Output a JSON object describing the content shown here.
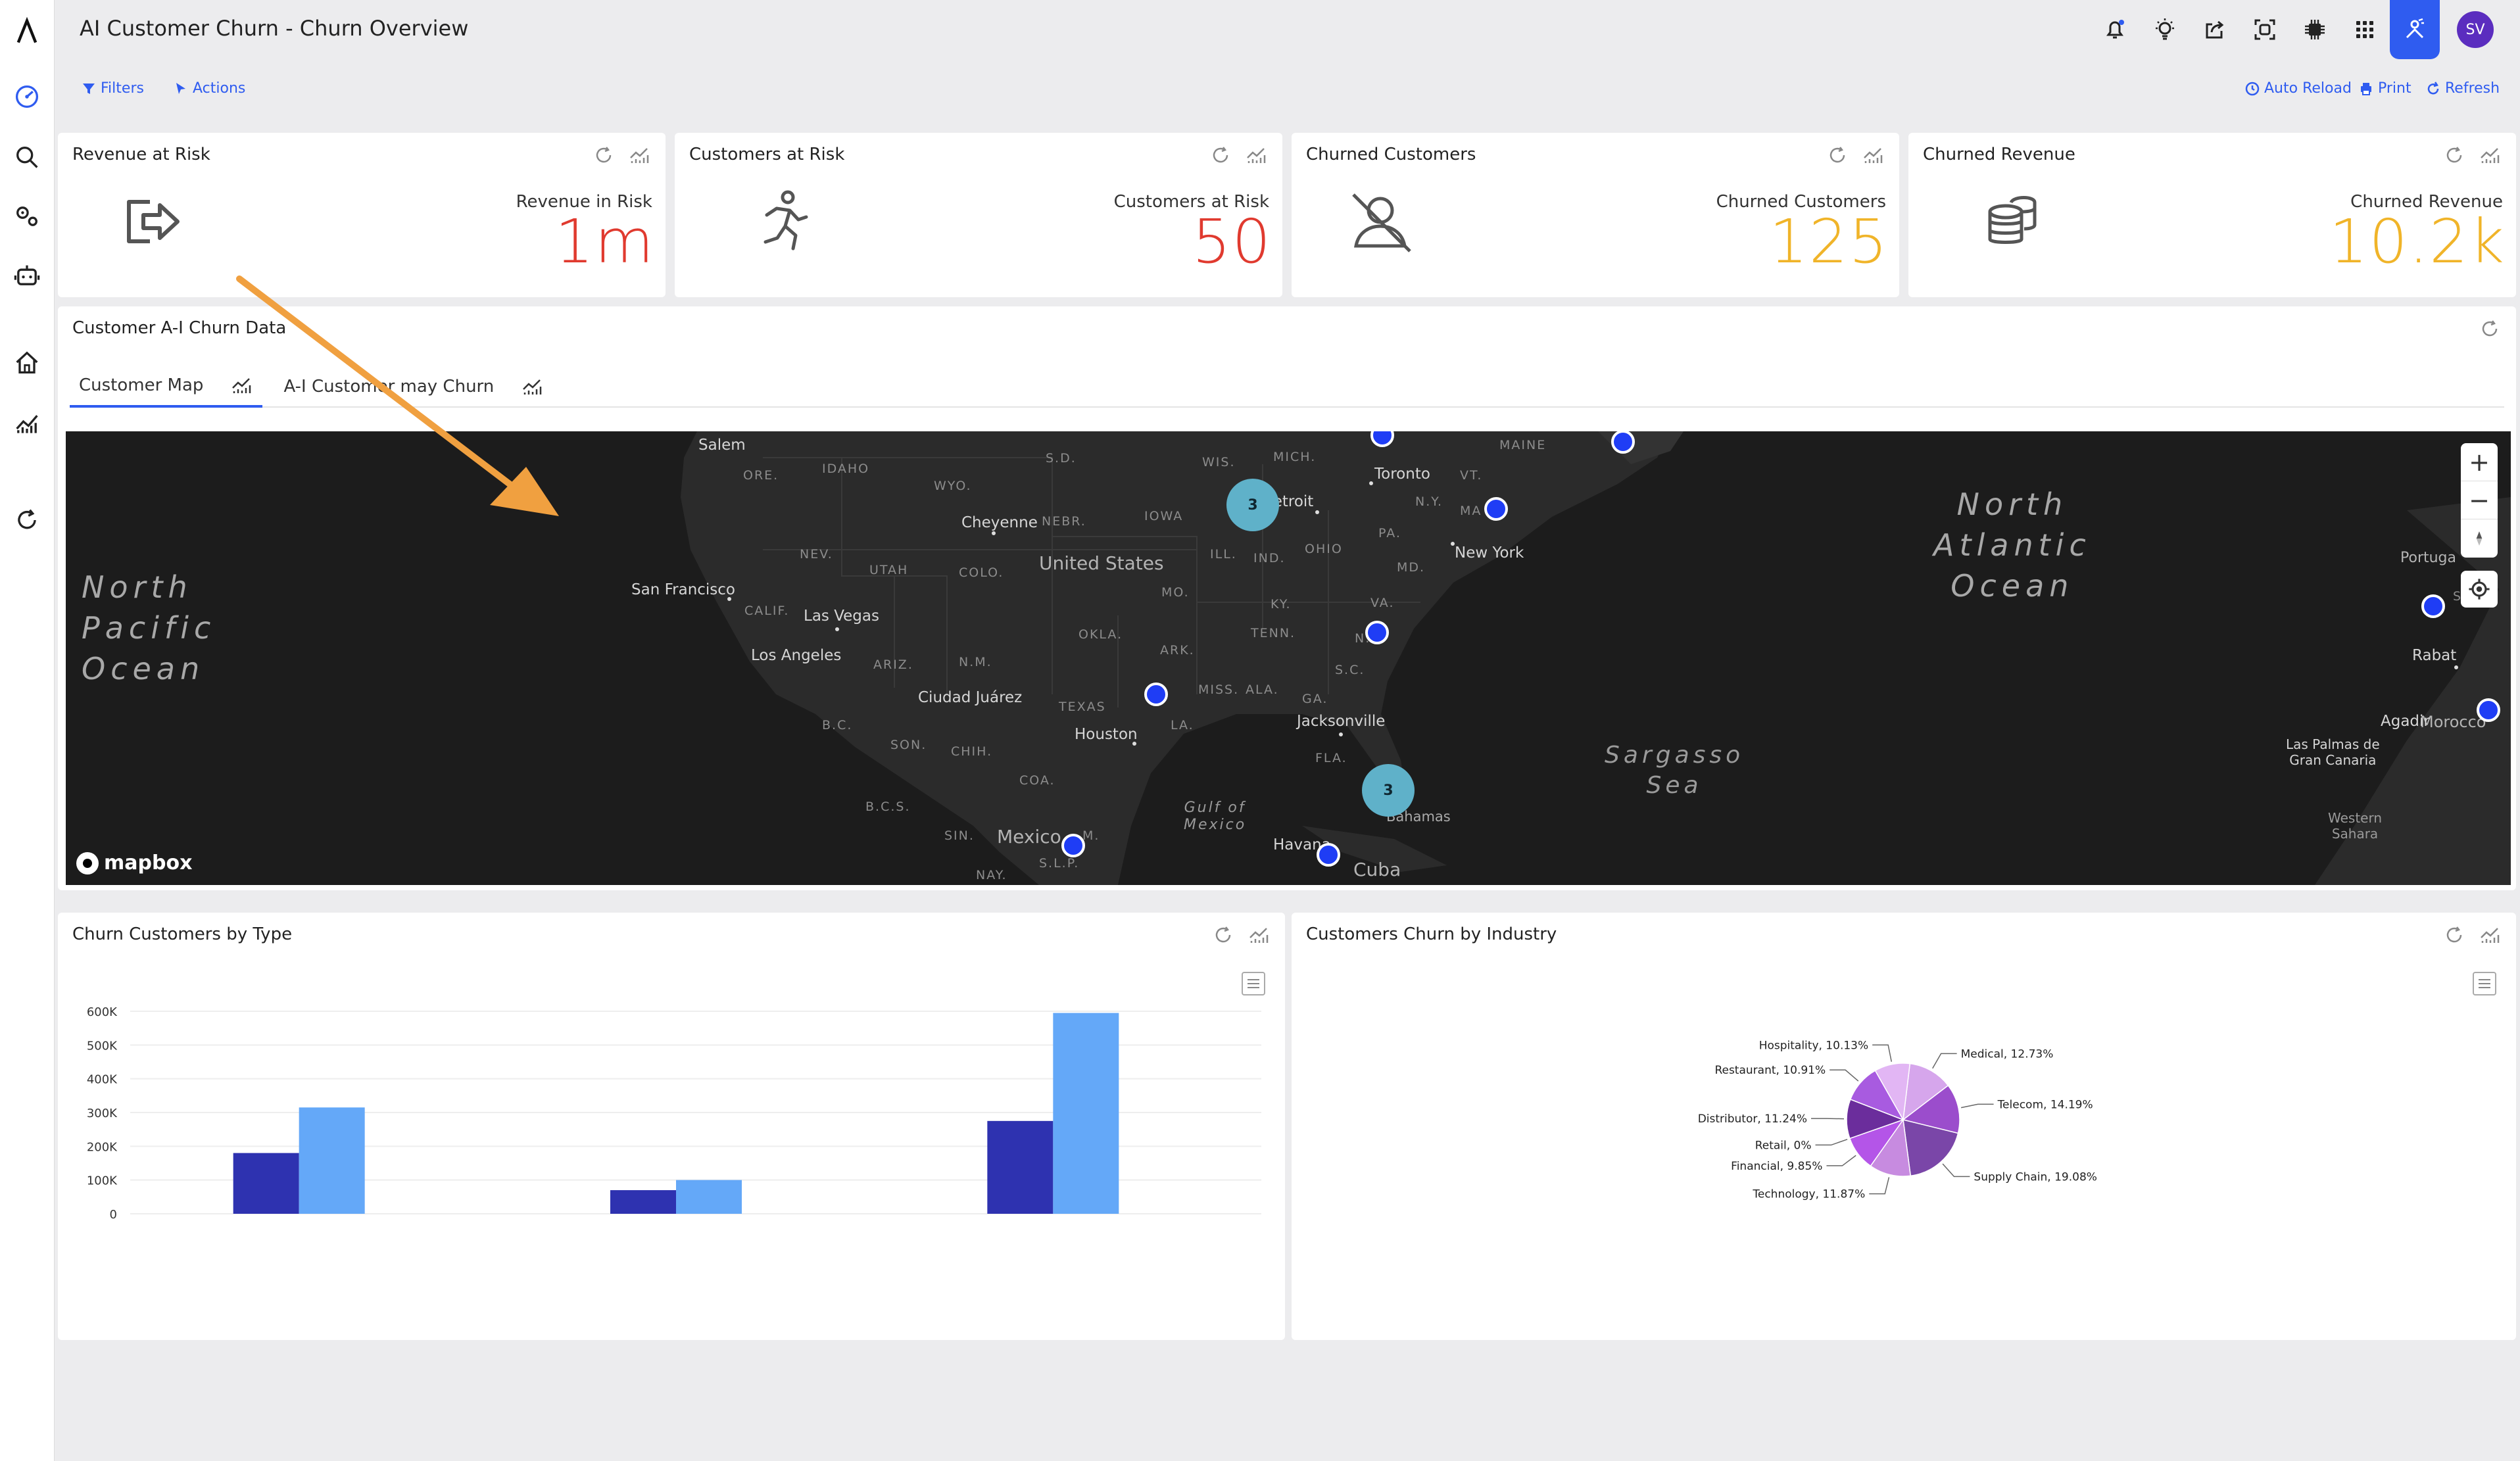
{
  "app": {
    "title": "AI Customer Churn - Churn Overview"
  },
  "user": {
    "initials": "SV"
  },
  "toolbar": {
    "filters": "Filters",
    "actions": "Actions",
    "auto_reload": "Auto Reload",
    "print": "Print",
    "refresh": "Refresh"
  },
  "kpis": [
    {
      "title": "Revenue at Risk",
      "label": "Revenue in Risk",
      "value": "1m",
      "color": "#e03a2f",
      "icon": "exit-icon"
    },
    {
      "title": "Customers at Risk",
      "label": "Customers at Risk",
      "value": "50",
      "color": "#e03a2f",
      "icon": "running-person-icon"
    },
    {
      "title": "Churned Customers",
      "label": "Churned Customers",
      "value": "125",
      "color": "#f0b429",
      "icon": "user-off-icon"
    },
    {
      "title": "Churned Revenue",
      "label": "Churned Revenue",
      "value": "10.2k",
      "color": "#f0b429",
      "icon": "coins-icon"
    }
  ],
  "churn_panel": {
    "title": "Customer A-I Churn Data",
    "tabs": [
      "Customer Map",
      "A-I Customer may Churn"
    ]
  },
  "map": {
    "oceans": {
      "pacific": "North\nPacific\nOcean",
      "atlantic": "North\nAtlantic\nOcean"
    },
    "seas": {
      "sargasso": "Sargasso\nSea",
      "gulf": "Gulf of\nMexico"
    },
    "countries": {
      "us": "United States",
      "mexico": "Mexico",
      "cuba": "Cuba",
      "morocco": "Morocco",
      "portugal": "Portuga",
      "western_sahara": "Western\nSahara"
    },
    "cities": {
      "salem": "Salem",
      "sf": "San Francisco",
      "lv": "Las Vegas",
      "la": "Los Angeles",
      "cheyenne": "Cheyenne",
      "cj": "Ciudad Juárez",
      "houston": "Houston",
      "jacksonville": "Jacksonville",
      "toronto": "Toronto",
      "detroit": "Detroit",
      "newyork": "New York",
      "havana": "Havana",
      "bahamas": "Bahamas",
      "rabat": "Rabat",
      "agadir": "Agadir",
      "laspalmas": "Las Palmas de\nGran Canaria"
    },
    "states": {
      "ore": "ORE.",
      "idaho": "IDAHO",
      "wyo": "WYO.",
      "nev": "NEV.",
      "utah": "UTAH",
      "colo": "COLO.",
      "calif": "CALIF.",
      "ariz": "ARIZ.",
      "nm": "N.M.",
      "nebr": "NEBR.",
      "iowa": "IOWA",
      "sd": "S.D.",
      "wis": "WIS.",
      "mich": "MICH.",
      "ill": "ILL.",
      "ind": "IND.",
      "ohio": "OHIO",
      "pa": "PA.",
      "ny": "N.Y.",
      "vt": "VT.",
      "maine": "MAINE",
      "ma": "MA",
      "md": "MD.",
      "va": "VA.",
      "ky": "KY.",
      "tenn": "TENN.",
      "mo": "MO.",
      "okla": "OKLA.",
      "ark": "ARK.",
      "texas": "TEXAS",
      "la": "LA.",
      "miss": "MISS.",
      "ala": "ALA.",
      "ga": "GA.",
      "sc": "S.C.",
      "fla": "FLA.",
      "nc": "N.",
      "bc": "B.C.",
      "son": "SON.",
      "chih": "CHIH.",
      "coa": "COA.",
      "bcs": "B.C.S.",
      "sin": "SIN.",
      "nay": "NAY.",
      "slp": "S.L.P.",
      "mex": "M.",
      "s": "S"
    },
    "clusters": [
      "3",
      "3"
    ],
    "attribution": "mapbox",
    "zoom_in": "+",
    "zoom_out": "−"
  },
  "bar_panel": {
    "title": "Churn Customers by Type"
  },
  "pie_panel": {
    "title": "Customers Churn by Industry"
  },
  "chart_data": [
    {
      "type": "bar",
      "title": "Churn Customers by Type",
      "categories": [
        "",
        "",
        ""
      ],
      "series": [
        {
          "values": [
            180000,
            70000,
            275000
          ],
          "color": "#2e32b0"
        },
        {
          "values": [
            315000,
            100000,
            595000
          ],
          "color": "#64a8f8"
        }
      ],
      "yticks": [
        "0",
        "100K",
        "200K",
        "300K",
        "400K",
        "500K",
        "600K"
      ],
      "ylim": [
        0,
        600000
      ],
      "grid": true
    },
    {
      "type": "pie",
      "title": "Customers Churn by Industry",
      "slices": [
        {
          "label": "Medical, 12.73%",
          "value": 12.73,
          "color": "#d6a6ec"
        },
        {
          "label": "Telecom, 14.19%",
          "value": 14.19,
          "color": "#9b4dcc"
        },
        {
          "label": "Supply Chain, 19.08%",
          "value": 19.08,
          "color": "#7a46a8"
        },
        {
          "label": "Technology, 11.87%",
          "value": 11.87,
          "color": "#c78be0"
        },
        {
          "label": "Financial, 9.85%",
          "value": 9.85,
          "color": "#b455e8"
        },
        {
          "label": "Retail, 0%",
          "value": 0,
          "color": "#8a3fb8"
        },
        {
          "label": "Distributor, 11.24%",
          "value": 11.24,
          "color": "#6b2d9c"
        },
        {
          "label": "Restaurant, 10.91%",
          "value": 10.91,
          "color": "#a85be0"
        },
        {
          "label": "Hospitality, 10.13%",
          "value": 10.13,
          "color": "#e2b6f4"
        }
      ]
    }
  ]
}
